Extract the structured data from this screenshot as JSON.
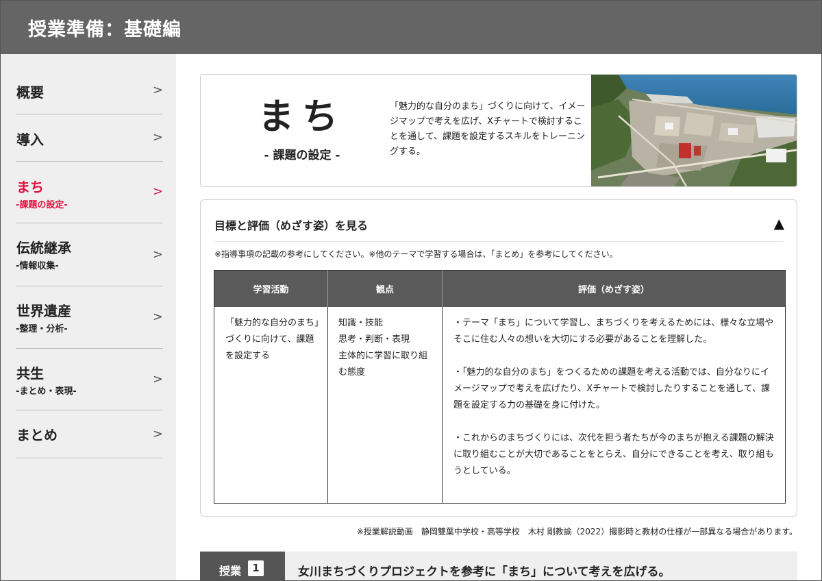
{
  "header": {
    "title": "授業準備：基礎編"
  },
  "sidebar": {
    "items": [
      {
        "label": "概要",
        "sub": ""
      },
      {
        "label": "導入",
        "sub": ""
      },
      {
        "label": "まち",
        "sub": "-課題の設定-"
      },
      {
        "label": "伝統継承",
        "sub": "-情報収集-"
      },
      {
        "label": "世界遺産",
        "sub": "-整理・分析-"
      },
      {
        "label": "共生",
        "sub": "-まとめ・表現-"
      },
      {
        "label": "まとめ",
        "sub": ""
      }
    ],
    "chevron": ">",
    "active_index": 2
  },
  "hero": {
    "theme": "まち",
    "subtitle": "- 課題の設定 -",
    "description": "「魅力的な自分のまち」づくりに向けて、イメージマップで考えを広げ、Xチャートで検討することを通して、課題を設定するスキルをトレーニングする。"
  },
  "panel": {
    "title": "目標と評価（めざす姿）を見る",
    "toggle_icon": "▲",
    "note": "※指導事項の記載の参考にしてください。※他のテーマで学習する場合は、「まとめ」を参考にしてください。",
    "table": {
      "headers": [
        "学習活動",
        "観点",
        "評価（めざす姿）"
      ],
      "activity": "「魅力的な自分のまち」づくりに向けて、課題を設定する",
      "viewpoints": [
        "知識・技能",
        "思考・判断・表現",
        "主体的に学習に取り組む態度"
      ],
      "evaluations": [
        "・テーマ「まち」について学習し、まちづくりを考えるためには、様々な立場やそこに住む人々の想いを大切にする必要があることを理解した。",
        "・「魅力的な自分のまち」をつくるための課題を考える活動では、自分なりにイメージマップで考えを広げたり、Xチャートで検討したりすることを通して、課題を設定する力の基礎を身に付けた。",
        "・これからのまちづくりには、次代を担う者たちが今のまちが抱える課題の解決に取り組むことが大切であることをとらえ、自分にできることを考え、取り組もうとしている。"
      ]
    }
  },
  "credit": "※授業解説動画　静岡雙葉中学校・高等学校　木村 剛教諭（2022）撮影時と教材の仕様が一部異なる場合があります。",
  "lesson": {
    "tag": "授業",
    "number": "1",
    "title": "女川まちづくりプロジェクトを参考に「まち」について考えを広げる。"
  },
  "colors": {
    "header_bg": "#656565",
    "sidebar_bg": "#efefef",
    "active": "#e0103e",
    "table_header_bg": "#5a5a5a"
  }
}
